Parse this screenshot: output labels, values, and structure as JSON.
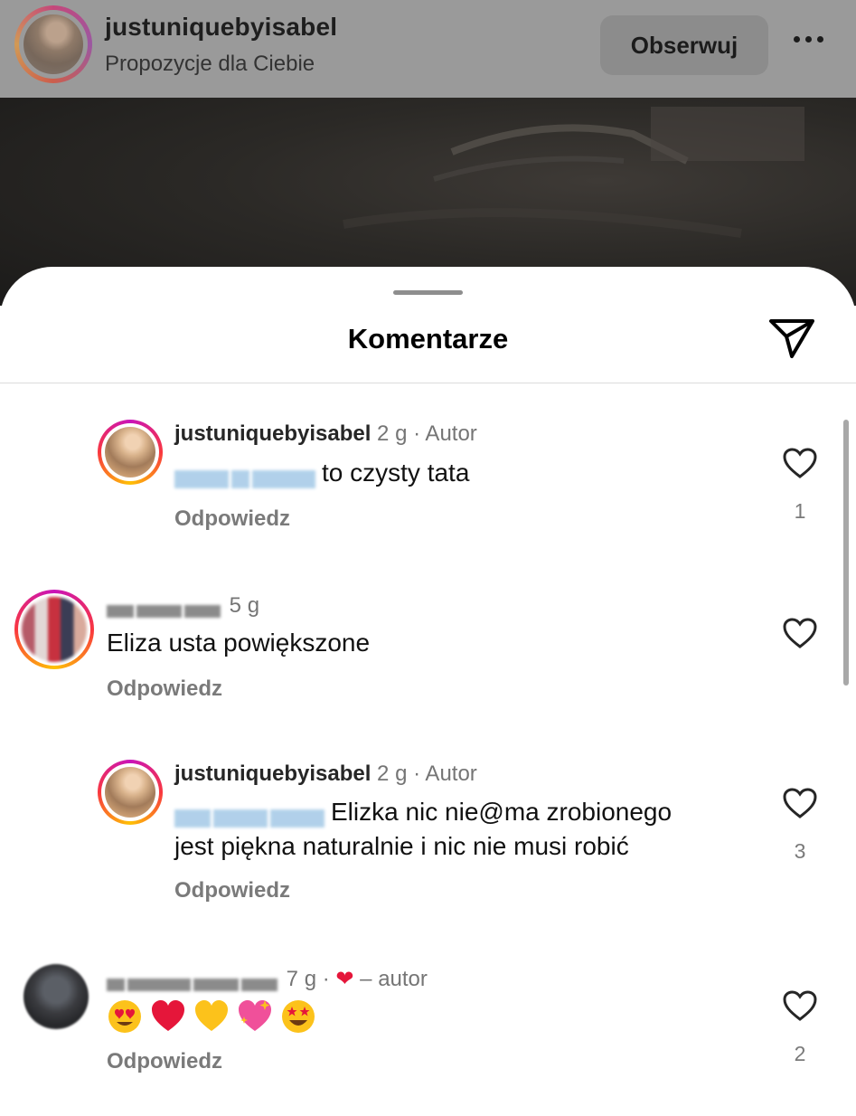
{
  "post": {
    "username": "justuniquebyisabel",
    "subtitle": "Propozycje dla Ciebie",
    "follow_label": "Obserwuj",
    "more_icon": "more-horizontal-icon"
  },
  "sheet": {
    "title": "Komentarze",
    "share_icon": "paper-plane-icon"
  },
  "comments": [
    {
      "username": "justuniquebyisabel",
      "time": "2 g",
      "badge": "· Autor",
      "text": "to czysty tata",
      "reply_label": "Odpowiedz",
      "likes": "1"
    },
    {
      "username": "",
      "time": "5 g",
      "text": "Eliza usta powiększone",
      "reply_label": "Odpowiedz",
      "likes": ""
    },
    {
      "username": "justuniquebyisabel",
      "time": "2 g",
      "badge": "· Autor",
      "text_line1": "Elizka nic nie@ma zrobionego",
      "text_line2": "jest piękna naturalnie i nic nie musi robić",
      "reply_label": "Odpowiedz",
      "likes": "3"
    },
    {
      "username": "",
      "time": "7 g",
      "liked_by": "– autor",
      "emojis": [
        "heart-eyes-emoji",
        "red-heart-emoji",
        "yellow-heart-emoji",
        "sparkling-heart-emoji",
        "star-struck-emoji"
      ],
      "reply_label": "Odpowiedz",
      "likes": "2"
    }
  ],
  "colors": {
    "heart_red": "#e5163a",
    "story_ring": "#c913b9"
  }
}
